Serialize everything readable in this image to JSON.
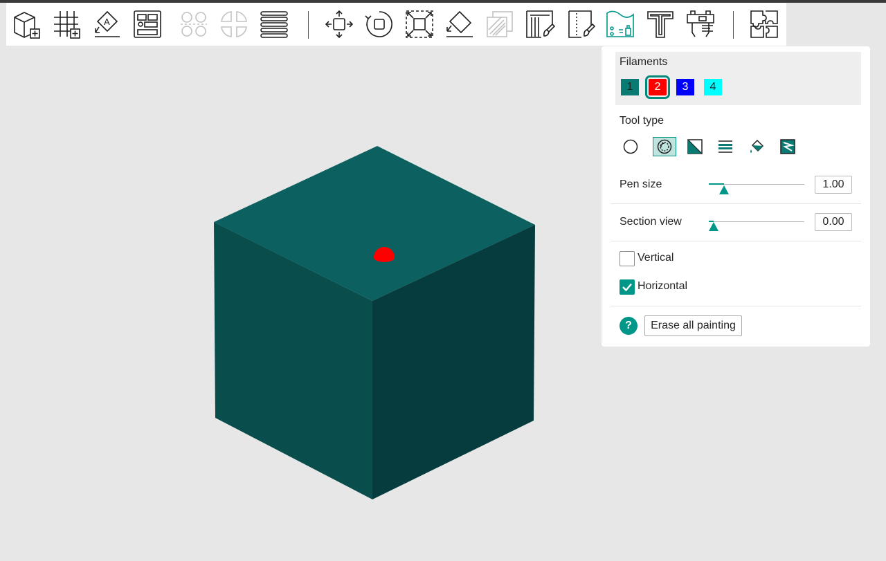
{
  "colors": {
    "accent": "#009688",
    "cube_top": "#0d6060",
    "cube_left": "#0a4d4d",
    "cube_right": "#063c3d",
    "paint_dot": "#ff0000"
  },
  "toolbar": {
    "buttons": [
      {
        "name": "add-object-icon",
        "enabled": true
      },
      {
        "name": "add-plate-icon",
        "enabled": true
      },
      {
        "name": "orient-icon",
        "enabled": true
      },
      {
        "name": "arrange-icon",
        "enabled": true
      },
      {
        "name": "split-objects-icon",
        "enabled": false
      },
      {
        "name": "split-parts-icon",
        "enabled": false
      },
      {
        "name": "layers-icon",
        "enabled": true
      },
      {
        "name": "move-icon",
        "enabled": true
      },
      {
        "name": "rotate-icon",
        "enabled": true
      },
      {
        "name": "scale-icon",
        "enabled": true
      },
      {
        "name": "lay-on-face-icon",
        "enabled": true
      },
      {
        "name": "cut-icon",
        "enabled": false
      },
      {
        "name": "support-paint-icon",
        "enabled": true
      },
      {
        "name": "seam-paint-icon",
        "enabled": true
      },
      {
        "name": "color-paint-icon",
        "enabled": true,
        "active": true
      },
      {
        "name": "text-icon",
        "enabled": true
      },
      {
        "name": "measure-icon",
        "enabled": true
      },
      {
        "name": "assembly-icon",
        "enabled": true
      }
    ]
  },
  "panel": {
    "filaments_title": "Filaments",
    "filaments": [
      {
        "label": "1",
        "color": "#0a7b73",
        "text_color": "#222222",
        "selected": false
      },
      {
        "label": "2",
        "color": "#ff0000",
        "text_color": "#ffffff",
        "selected": true
      },
      {
        "label": "3",
        "color": "#0000ff",
        "text_color": "#ffffff",
        "selected": false
      },
      {
        "label": "4",
        "color": "#00ffff",
        "text_color": "#222222",
        "selected": false
      }
    ],
    "tool_type_title": "Tool type",
    "tools": [
      {
        "name": "circle-tool-icon",
        "active": false
      },
      {
        "name": "sphere-tool-icon",
        "active": true
      },
      {
        "name": "triangle-tool-icon",
        "active": false
      },
      {
        "name": "height-range-tool-icon",
        "active": false
      },
      {
        "name": "fill-tool-icon",
        "active": false
      },
      {
        "name": "gap-fill-tool-icon",
        "active": false
      }
    ],
    "pen_size": {
      "label": "Pen size",
      "value": "1.00",
      "fraction": 0.16
    },
    "section_view": {
      "label": "Section view",
      "value": "0.00",
      "fraction": 0.05
    },
    "vertical": {
      "label": "Vertical",
      "checked": false
    },
    "horizontal": {
      "label": "Horizontal",
      "checked": true
    },
    "help_glyph": "?",
    "erase_label": "Erase all painting"
  }
}
